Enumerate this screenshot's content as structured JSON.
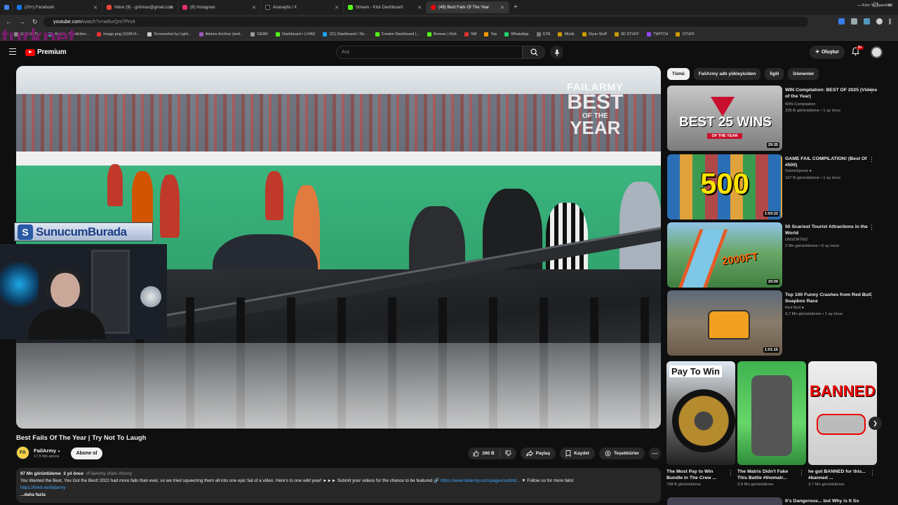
{
  "browser": {
    "tabs": [
      {
        "title": "(20+) Facebook",
        "color": "#1877f2"
      },
      {
        "title": "Inbox (9) - grimnas@gmail.com",
        "color": "#ea4335"
      },
      {
        "title": "(8) Instagram",
        "color": "#e1306c"
      },
      {
        "title": "Anasayfa / X",
        "color": "#111111"
      },
      {
        "title": "Stream - Kick Dashboard",
        "color": "#53fc18"
      },
      {
        "title": "(49) Best Fails Of The Year",
        "color": "#ff0000",
        "active": true
      }
    ],
    "url_host": "youtube.com",
    "url_path": "/watch?v=w6urQm7Prs4",
    "bookmarks": [
      "GLE ANTI...",
      "Kalshi - Prediction...",
      "image.png (1038×5...",
      "Screenshot by Light...",
      "Adams Archive (and...",
      "GEAR",
      "Dashboard • LIVAD",
      "(21) Dashboard / Str...",
      "Creator Dashboard |...",
      "Browse | Kick",
      "SM",
      "Top",
      "WhatsApp",
      "GTA",
      "Müzik",
      "Oyun Stuff",
      "3D STUFF",
      "TWITCH",
      "STUFF"
    ],
    "all_bookmarks": "Tüm Yer İşaretleri"
  },
  "overlay": {
    "turknet": "turknet",
    "sunucum": "SunucumBurada",
    "sunucum_logo": "S"
  },
  "header": {
    "logo_text": "Premium",
    "search_placeholder": "Ara",
    "create_label": "Oluştur",
    "notif_badge": "9+"
  },
  "video": {
    "watermark": [
      "FAILARMY",
      "BEST",
      "OF THE",
      "YEAR"
    ],
    "title": "Best Fails Of The Year | Try Not To Laugh",
    "channel": "FailArmy",
    "channel_initials": "FA",
    "subscribers": "17,5 Mn abone",
    "subscribe_label": "Abone ol",
    "likes": "260 B",
    "share_label": "Paylaş",
    "save_label": "Kaydet",
    "thanks_label": "Teşekkürler",
    "views": "97 Mn görüntüleme",
    "age": "3 yıl önce",
    "tags": "#FailArmy #fails #funny",
    "description": "You Wanted the Best, You Got the Best! 2022 had more fails than ever, so we tried squeezing them all into one epic fail of a video. Here's to one wild year! ►►► Submit your videos for the chance to be featured 🔗",
    "desc_link": "https://www.failarmy.com/pages/submit...",
    "desc_follow": "▼ Follow us for more fails!",
    "desc_link2": "https://linktr.ee/failarmy",
    "more": "...daha fazla"
  },
  "filters": [
    "Tümü",
    "FailArmy adlı yükleyiciden",
    "İlgili",
    "İzlenenler"
  ],
  "recommendations": [
    {
      "title": "WIN Compilation: BEST OF 2025 (Videos of the Year)",
      "channel": "WIN Compilation",
      "meta": "336 B görüntüleme • 1 ay önce",
      "duration": "29:35",
      "thumb_text": "BEST 25 WINS",
      "thumb_sub": "OF THE YEAR"
    },
    {
      "title": "GAME FAIL COMPILATION! (Best Of #500)",
      "channel": "GameSprout",
      "meta": "167 B görüntüleme • 1 ay önce",
      "duration": "1:03:22",
      "thumb_text": "500"
    },
    {
      "title": "50 Scariest Tourist Attractions in the World",
      "channel": "UNSORTED",
      "meta": "2 Mn görüntüleme • 6 ay önce",
      "duration": "29:09",
      "thumb_text": "2000FT"
    },
    {
      "title": "Top 100 Funny Crashes from Red Bull Soapbox Race",
      "channel": "Red Bull",
      "meta": "3,7 Mn görüntüleme • 1 ay önce",
      "duration": "1:01:16"
    }
  ],
  "shorts": [
    {
      "title": "The Most Pay to Win Bundle in The Crew ...",
      "meta": "798 B görüntüleme",
      "thumb_text": "Pay To Win"
    },
    {
      "title": "The Matrix Didn't Fake This Battle #thematr...",
      "meta": "3,9 Mn görüntüleme"
    },
    {
      "title": "he got BANNED for this... #banned ...",
      "meta": "3,7 Mn görüntüleme",
      "thumb_text": "BANNED"
    }
  ],
  "bottom_rec": {
    "title": "It's Dangerous... but Why is It So"
  }
}
